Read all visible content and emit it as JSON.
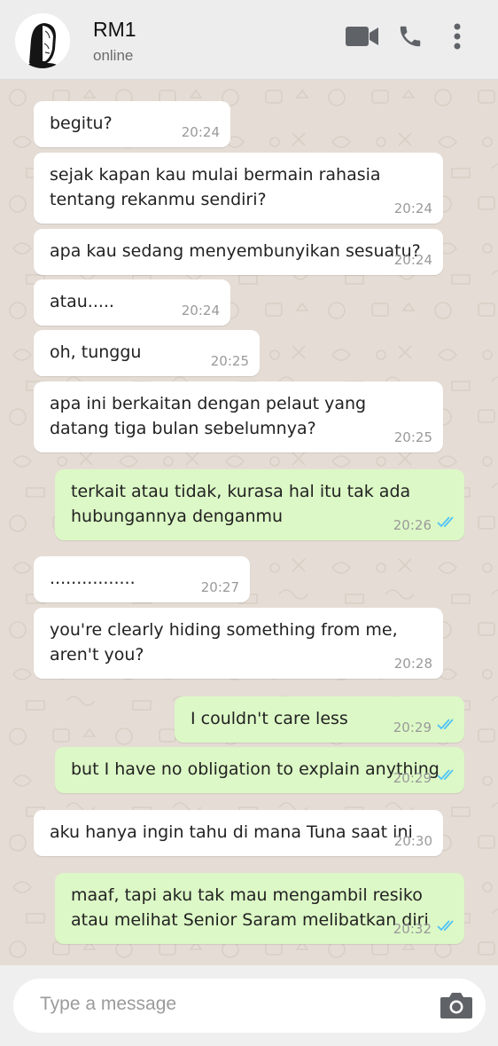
{
  "header": {
    "contact_name": "RM1",
    "status": "online",
    "icons": [
      "video-call-icon",
      "voice-call-icon",
      "more-options-icon"
    ]
  },
  "messages": [
    {
      "dir": "in",
      "text": "begitu?",
      "time": "20:24"
    },
    {
      "dir": "in",
      "text": "sejak kapan kau mulai bermain rahasia tentang rekanmu sendiri?",
      "time": "20:24"
    },
    {
      "dir": "in",
      "text": "apa kau sedang menyembunyikan sesuatu?",
      "time": "20:24"
    },
    {
      "dir": "in",
      "text": "atau.....",
      "time": "20:24"
    },
    {
      "dir": "in",
      "text": "oh, tunggu",
      "time": "20:25"
    },
    {
      "dir": "in",
      "text": "apa ini berkaitan dengan pelaut yang datang tiga bulan sebelumnya?",
      "time": "20:25"
    },
    {
      "dir": "out",
      "text": "terkait atau tidak, kurasa hal itu tak ada hubungannya denganmu",
      "time": "20:26",
      "read": true
    },
    {
      "dir": "in",
      "text": "................",
      "time": "20:27"
    },
    {
      "dir": "in",
      "text": "you're clearly hiding something from me, aren't you?",
      "time": "20:28"
    },
    {
      "dir": "out",
      "text": "I couldn't care less",
      "time": "20:29",
      "read": true
    },
    {
      "dir": "out",
      "text": "but I have no obligation to explain anything",
      "time": "20:29",
      "read": true
    },
    {
      "dir": "in",
      "text": "aku hanya ingin tahu di mana Tuna saat ini",
      "time": "20:30"
    },
    {
      "dir": "out",
      "text": "maaf, tapi aku tak mau mengambil resiko atau melihat Senior Saram melibatkan diri",
      "time": "20:32",
      "read": true
    }
  ],
  "composer": {
    "placeholder": "Type a message",
    "camera_icon": "camera-icon"
  },
  "colors": {
    "chat_background": "#e5ddd5",
    "incoming_bubble": "#ffffff",
    "outgoing_bubble": "#dcf8c6",
    "read_ticks": "#4fc3f7",
    "header": "#ededed",
    "icon_gray": "#5f6368"
  }
}
